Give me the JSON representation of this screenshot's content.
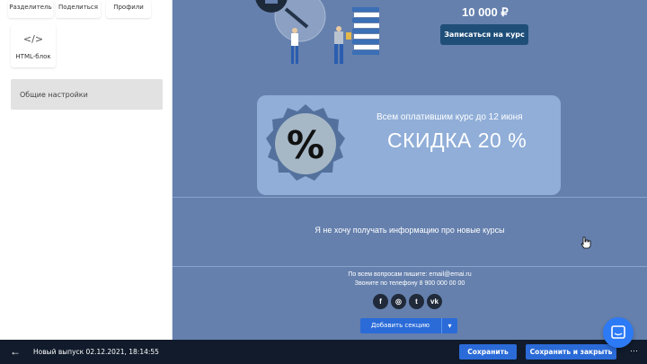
{
  "sidebar": {
    "blocks": [
      {
        "label": "Разделитель"
      },
      {
        "label": "Поделиться"
      },
      {
        "label": "Профили"
      }
    ],
    "html_block": {
      "label": "HTML-блок",
      "icon": "code-icon"
    },
    "settings_label": "Общие настройки"
  },
  "email": {
    "price": "10 000 ₽",
    "enroll_button": "Записаться на курс",
    "promo": {
      "subtitle": "Всем оплатившим курс до 12 июня",
      "title": "СКИДКА 20 %"
    },
    "unsubscribe_text": "Я не хочу получать информацию про новые курсы",
    "footer": {
      "email_line": "По всем вопросам пишите: email@emai.ru",
      "phone_line": "Звоните по телефону  8 900 000 00 00"
    },
    "socials": [
      {
        "icon": "facebook-icon",
        "glyph": "f"
      },
      {
        "icon": "instagram-icon",
        "glyph": "◎"
      },
      {
        "icon": "twitter-icon",
        "glyph": "t"
      },
      {
        "icon": "vk-icon",
        "glyph": "vk"
      }
    ]
  },
  "editor": {
    "add_section": "Добавить секцию"
  },
  "bottombar": {
    "issue_name": "Новый выпуск 02.12.2021, 18:14:55",
    "save": "Сохранить",
    "save_close": "Сохранить и закрыть"
  },
  "colors": {
    "canvas_bg": "#6580ad",
    "promo_bg": "#90aed8",
    "accent": "#2a6bd8",
    "bottombar_bg": "#111b2b"
  }
}
